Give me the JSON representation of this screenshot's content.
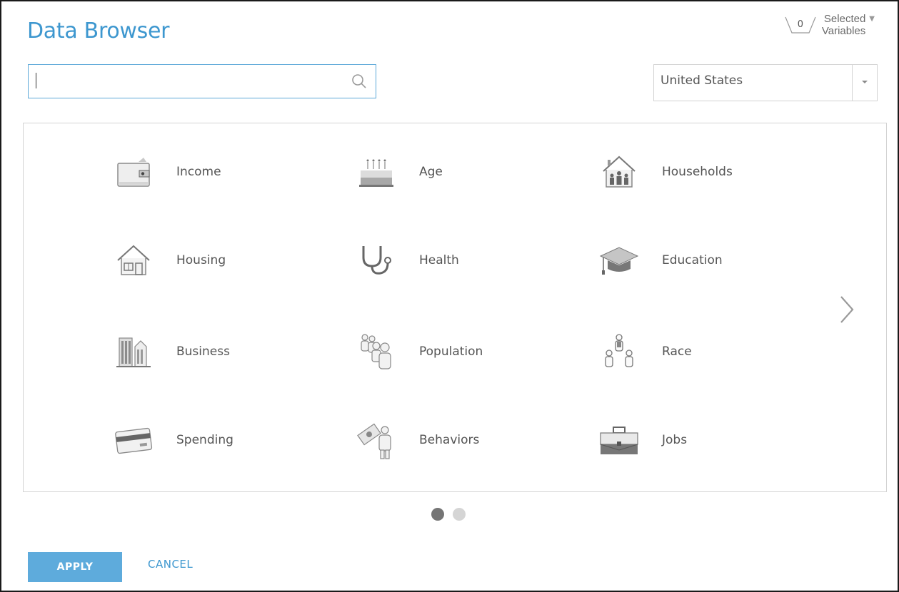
{
  "header": {
    "title": "Data Browser",
    "selected_count": "0",
    "selected_label_line1": "Selected",
    "selected_label_line2": "Variables"
  },
  "search": {
    "value": "",
    "placeholder": ""
  },
  "geography": {
    "selected": "United States"
  },
  "categories": [
    {
      "label": "Income",
      "icon": "wallet-icon"
    },
    {
      "label": "Age",
      "icon": "birthday-cake-icon"
    },
    {
      "label": "Households",
      "icon": "house-family-icon"
    },
    {
      "label": "Housing",
      "icon": "house-icon"
    },
    {
      "label": "Health",
      "icon": "stethoscope-icon"
    },
    {
      "label": "Education",
      "icon": "graduation-cap-icon"
    },
    {
      "label": "Business",
      "icon": "buildings-icon"
    },
    {
      "label": "Population",
      "icon": "crowd-icon"
    },
    {
      "label": "Race",
      "icon": "people-group-icon"
    },
    {
      "label": "Spending",
      "icon": "credit-card-icon"
    },
    {
      "label": "Behaviors",
      "icon": "money-person-icon"
    },
    {
      "label": "Jobs",
      "icon": "briefcase-icon"
    }
  ],
  "pagination": {
    "pages": 2,
    "current": 1
  },
  "footer": {
    "apply_label": "APPLY",
    "cancel_label": "CANCEL"
  },
  "colors": {
    "accent": "#3d97cf",
    "apply_bg": "#5eabdc",
    "text": "#555555",
    "border": "#d3d3d3"
  }
}
